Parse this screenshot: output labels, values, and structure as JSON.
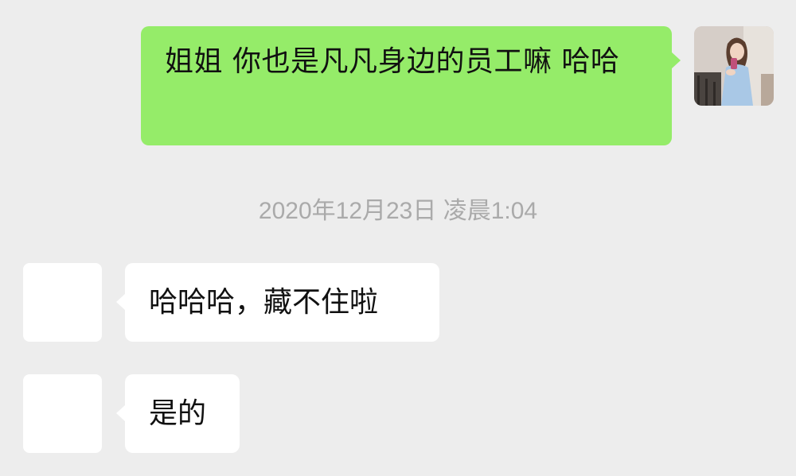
{
  "messages": [
    {
      "direction": "outgoing",
      "text": "姐姐 你也是凡凡身边的员工嘛 哈哈",
      "bubble_color": "#95ec69"
    },
    {
      "direction": "incoming",
      "text": "哈哈哈，藏不住啦",
      "bubble_color": "#ffffff"
    },
    {
      "direction": "incoming",
      "text": "是的",
      "bubble_color": "#ffffff"
    }
  ],
  "timestamp": "2020年12月23日 凌晨1:04",
  "colors": {
    "background": "#ededed",
    "outgoing_bubble": "#95ec69",
    "incoming_bubble": "#ffffff",
    "timestamp_text": "#aaaaaa"
  }
}
